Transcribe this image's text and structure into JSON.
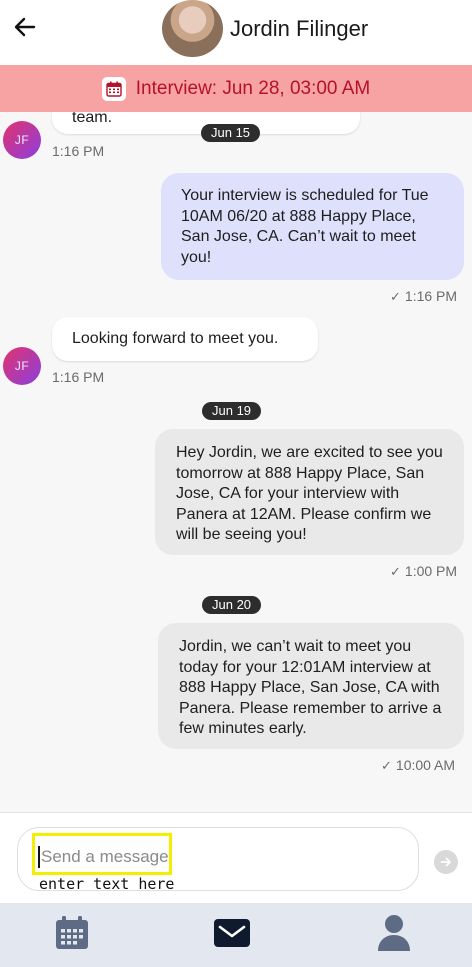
{
  "header": {
    "contact_name": "Jordin Filinger",
    "back_icon": "arrow-left-icon"
  },
  "banner": {
    "text": "Interview: Jun 28, 03:00 AM",
    "icon": "calendar-icon",
    "bg_color": "#f7a3a3",
    "text_color": "#b4122b"
  },
  "messages": [
    {
      "direction": "in",
      "text": "team.",
      "time": "1:16 PM",
      "avatar": "JF"
    },
    {
      "type": "date",
      "label": "Jun 15"
    },
    {
      "direction": "out",
      "text": "Your interview is scheduled for Tue 10AM 06/20 at 888 Happy Place, San Jose, CA. Can’t wait to meet you!",
      "time": "1:16 PM"
    },
    {
      "direction": "in",
      "text": "Looking forward to meet you.",
      "time": "1:16 PM",
      "avatar": "JF"
    },
    {
      "type": "date",
      "label": "Jun 19"
    },
    {
      "direction": "out",
      "text": "Hey Jordin, we are excited to see you tomorrow at 888 Happy Place, San Jose, CA for your interview with Panera at 12AM. Please confirm we will be seeing you!",
      "time": "1:00 PM"
    },
    {
      "type": "date",
      "label": "Jun 20"
    },
    {
      "direction": "out",
      "text": "Jordin, we can’t wait to meet you today for your 12:01AM interview at 888 Happy Place, San Jose, CA with Panera. Please remember to arrive a few minutes early.",
      "time": "10:00 AM"
    }
  ],
  "composer": {
    "placeholder": "Send a message",
    "hint": "enter text here",
    "send_icon": "arrow-right-circle-icon",
    "highlight_color": "#f4ef00"
  },
  "tabs": [
    {
      "name": "calendar",
      "icon": "calendar-icon"
    },
    {
      "name": "messages",
      "icon": "envelope-icon",
      "active": true
    },
    {
      "name": "profile",
      "icon": "person-icon"
    }
  ]
}
